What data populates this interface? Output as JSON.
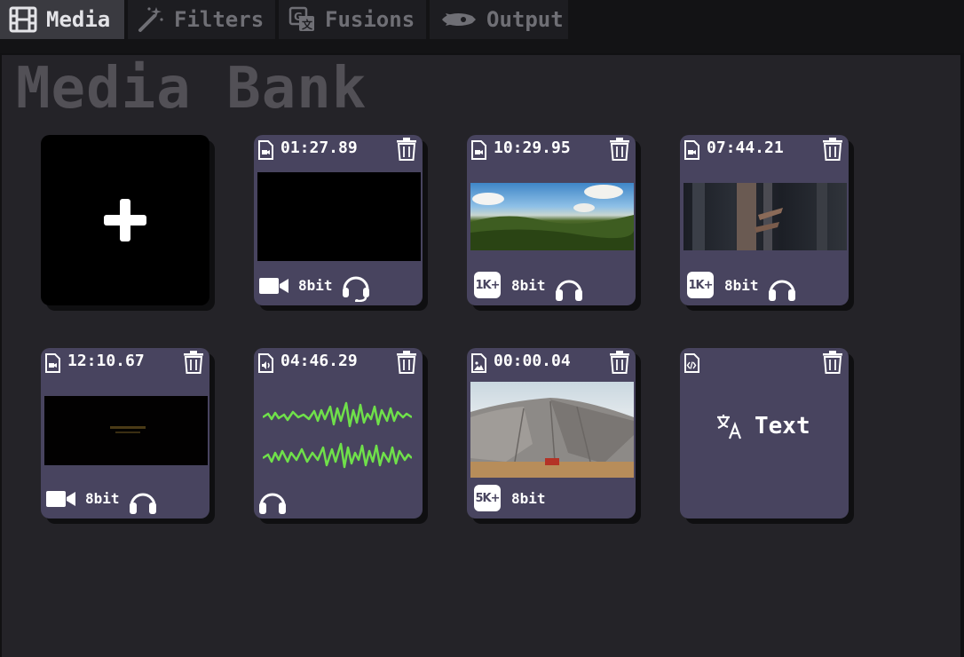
{
  "tabs": [
    {
      "label": "Media",
      "icon": "film-icon",
      "active": true
    },
    {
      "label": "Filters",
      "icon": "magic-wand-icon",
      "active": false
    },
    {
      "label": "Fusions",
      "icon": "translate-icon",
      "active": false
    },
    {
      "label": "Output",
      "icon": "rocket-icon",
      "active": false
    }
  ],
  "panel": {
    "title": "Media Bank"
  },
  "add_card": {
    "icon": "plus-icon"
  },
  "cards": [
    {
      "kind": "video-file",
      "duration": "01:27.89",
      "badge": "video-camera-icon",
      "bits": "8bit",
      "audio": "headset-icon",
      "thumb": "black"
    },
    {
      "kind": "video-file",
      "duration": "10:29.95",
      "badge": "1K+",
      "bits": "8bit",
      "audio": "headphones-icon",
      "thumb": "landscape"
    },
    {
      "kind": "video-file",
      "duration": "07:44.21",
      "badge": "1K+",
      "bits": "8bit",
      "audio": "headphones-icon",
      "thumb": "forest"
    },
    {
      "kind": "video-file",
      "duration": "12:10.67",
      "badge": "video-camera-icon",
      "bits": "8bit",
      "audio": "headphones-icon",
      "thumb": "dark-title"
    },
    {
      "kind": "audio-file",
      "duration": "04:46.29",
      "audio": "headphones-icon",
      "thumb": "waveform"
    },
    {
      "kind": "image-file",
      "duration": "00:00.04",
      "badge": "5K+",
      "bits": "8bit",
      "thumb": "mountain"
    },
    {
      "kind": "code-file",
      "label": "Text",
      "icon": "translate-icon"
    }
  ],
  "colors": {
    "card_bg": "#48445f",
    "panel_bg": "#242328",
    "waveform": "#6fe04a",
    "active_tab": "#3a3a40"
  }
}
